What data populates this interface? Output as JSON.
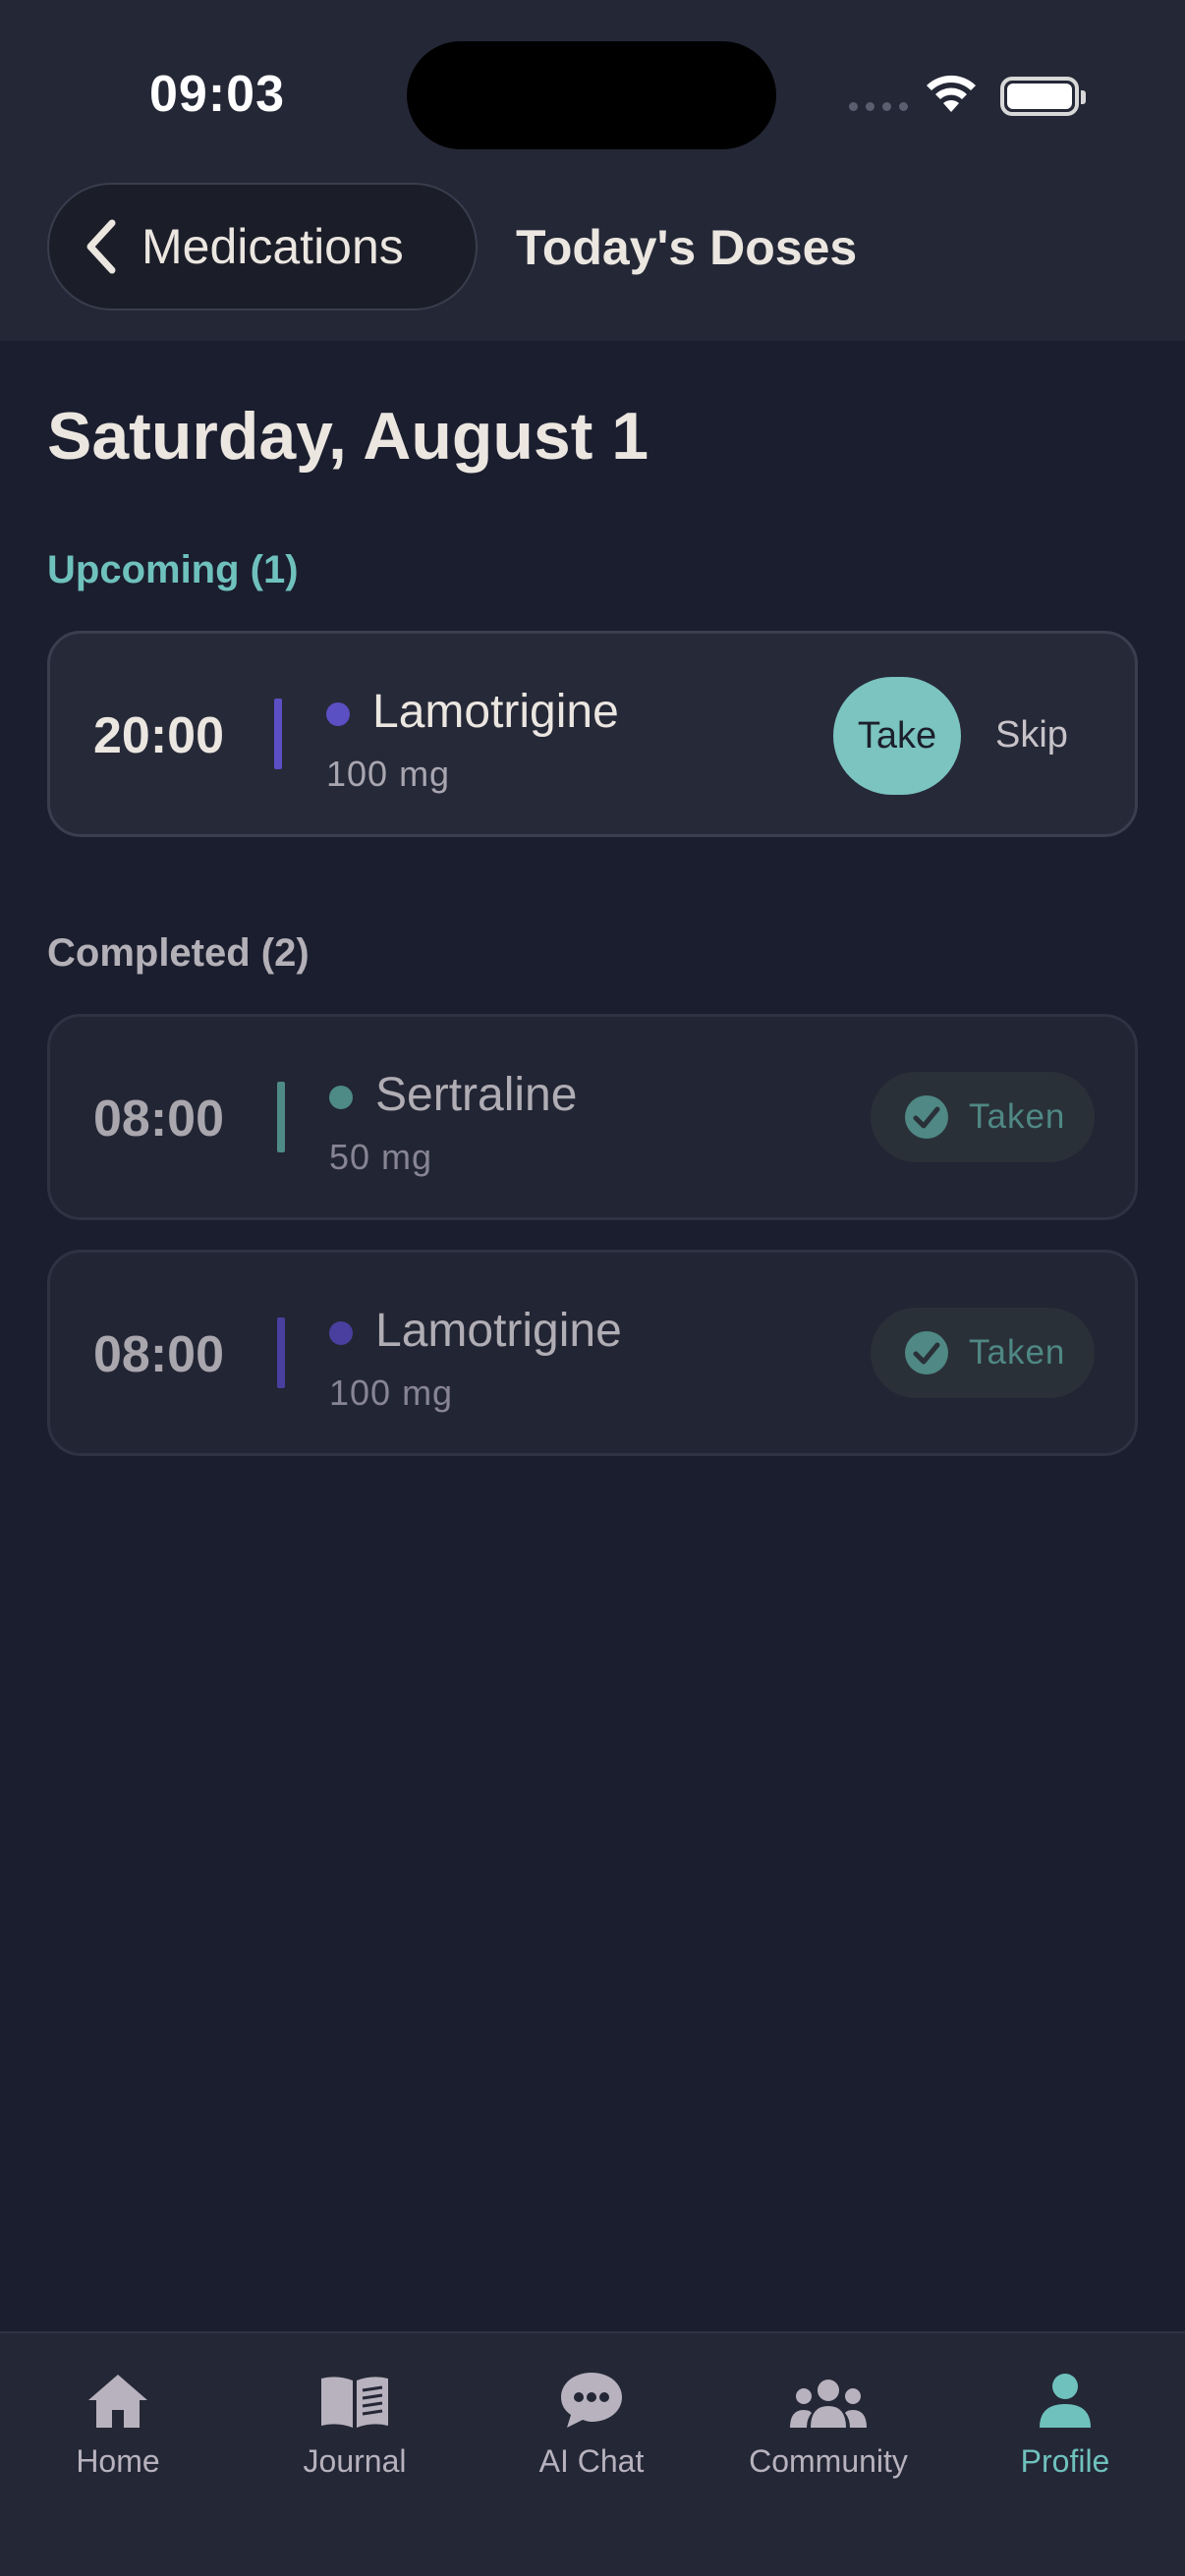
{
  "status_bar": {
    "time": "09:03"
  },
  "header": {
    "back_label": "Medications",
    "title": "Today's Doses"
  },
  "date_heading": "Saturday, August 1",
  "sections": {
    "upcoming": {
      "label": "Upcoming (1)",
      "doses": [
        {
          "time": "20:00",
          "name": "Lamotrigine",
          "amount": "100 mg",
          "color": "#5b4fc4",
          "take_label": "Take",
          "skip_label": "Skip"
        }
      ]
    },
    "completed": {
      "label": "Completed (2)",
      "doses": [
        {
          "time": "08:00",
          "name": "Sertraline",
          "amount": "50 mg",
          "color": "#4e8a86",
          "status": "Taken"
        },
        {
          "time": "08:00",
          "name": "Lamotrigine",
          "amount": "100 mg",
          "color": "#4a3f9e",
          "status": "Taken"
        }
      ]
    }
  },
  "tabbar": {
    "tabs": [
      {
        "label": "Home",
        "icon": "home-icon",
        "active": false
      },
      {
        "label": "Journal",
        "icon": "book-icon",
        "active": false
      },
      {
        "label": "AI Chat",
        "icon": "chat-bubble-icon",
        "active": false
      },
      {
        "label": "Community",
        "icon": "people-icon",
        "active": false
      },
      {
        "label": "Profile",
        "icon": "person-icon",
        "active": true
      }
    ]
  },
  "colors": {
    "accent": "#6fc1bd",
    "background": "#1b1e2e",
    "header_background": "#242736",
    "upcoming_lamotrigine": "#5b4fc4",
    "completed_sertraline": "#4e8a86",
    "completed_lamotrigine": "#4a3f9e"
  }
}
